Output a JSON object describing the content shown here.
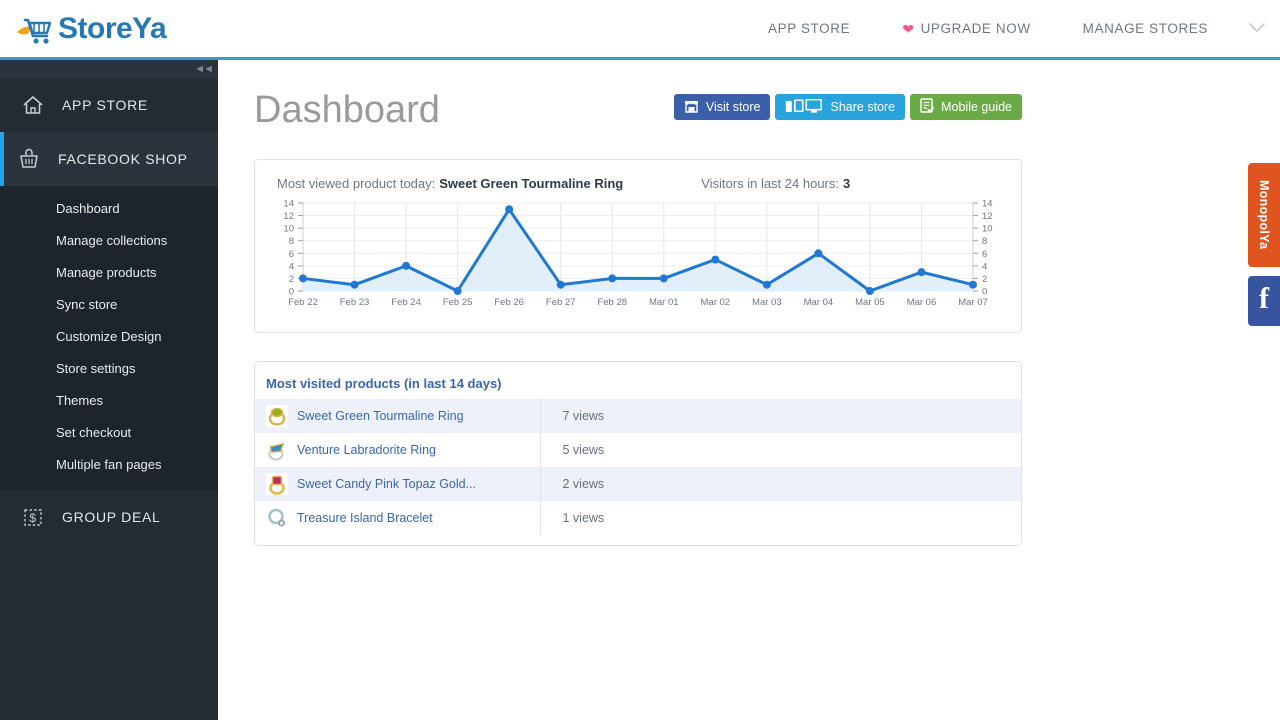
{
  "brand": {
    "name": "StoreYa",
    "logo_icon": "shopping-cart-icon",
    "color": "#2779b5"
  },
  "topnav": {
    "items": [
      {
        "label": "APP STORE",
        "icon": null
      },
      {
        "label": "UPGRADE NOW",
        "icon": "heart-icon",
        "icon_color": "#f4538f"
      },
      {
        "label": "MANAGE STORES",
        "icon": null
      }
    ],
    "chevron_icon": "chevron-down-icon"
  },
  "sidebar": {
    "collapse_icon": "double-chevron-left-icon",
    "groups": [
      {
        "label": "APP STORE",
        "icon": "home-icon",
        "active": false
      },
      {
        "label": "FACEBOOK SHOP",
        "icon": "basket-icon",
        "active": true
      },
      {
        "label": "GROUP DEAL",
        "icon": "dollar-tag-icon",
        "active": false
      }
    ],
    "sub_items": [
      "Dashboard",
      "Manage collections",
      "Manage products",
      "Sync store",
      "Customize Design",
      "Store settings",
      "Themes",
      "Set checkout",
      "Multiple fan pages"
    ],
    "active_accent": "#23a4e8"
  },
  "page": {
    "title": "Dashboard"
  },
  "toolbar": {
    "visit_store": {
      "label": "Visit store",
      "icon": "storefront-icon",
      "color": "#3b5fa8"
    },
    "share_store": {
      "label": "Share store",
      "icon": "devices-icon",
      "color": "#29a3dc"
    },
    "mobile_guide": {
      "label": "Mobile guide",
      "icon": "checklist-icon",
      "color": "#6aab46"
    }
  },
  "stats": {
    "most_viewed_label": "Most viewed product today:",
    "most_viewed_value": "Sweet Green Tourmaline Ring",
    "visitors_label": "Visitors in last 24 hours:",
    "visitors_value": "3"
  },
  "chart_data": {
    "type": "line",
    "title": "",
    "xlabel": "",
    "ylabel": "",
    "categories": [
      "Feb 22",
      "Feb 23",
      "Feb 24",
      "Feb 25",
      "Feb 26",
      "Feb 27",
      "Feb 28",
      "Mar 01",
      "Mar 02",
      "Mar 03",
      "Mar 04",
      "Mar 05",
      "Mar 06",
      "Mar 07"
    ],
    "values": [
      2,
      1,
      4,
      0,
      13,
      1,
      2,
      2,
      5,
      1,
      6,
      0,
      3,
      1
    ],
    "yticks": [
      0,
      2,
      4,
      6,
      8,
      10,
      12,
      14
    ],
    "ylim": [
      0,
      14
    ],
    "grid": true,
    "legend": "none",
    "dual_axis": true,
    "line_color": "#1f78d1",
    "fill_color": "#e3eefb",
    "marker": "circle"
  },
  "products_panel": {
    "title": "Most visited products (in last 14 days)",
    "rows": [
      {
        "name": "Sweet Green Tourmaline Ring",
        "views": "7 views",
        "thumb": "green-gem-ring-thumb"
      },
      {
        "name": "Venture Labradorite Ring",
        "views": "5 views",
        "thumb": "blue-gem-ring-thumb"
      },
      {
        "name": "Sweet Candy Pink Topaz Gold...",
        "views": "2 views",
        "thumb": "pink-gem-ring-thumb"
      },
      {
        "name": "Treasure Island Bracelet",
        "views": "1 views",
        "thumb": "silver-bracelet-thumb"
      }
    ]
  },
  "side_tabs": {
    "monopolya": {
      "label": "MonopolYa",
      "color": "#e0541f"
    },
    "facebook": {
      "label": "f",
      "color": "#37549e",
      "icon": "facebook-icon"
    }
  }
}
